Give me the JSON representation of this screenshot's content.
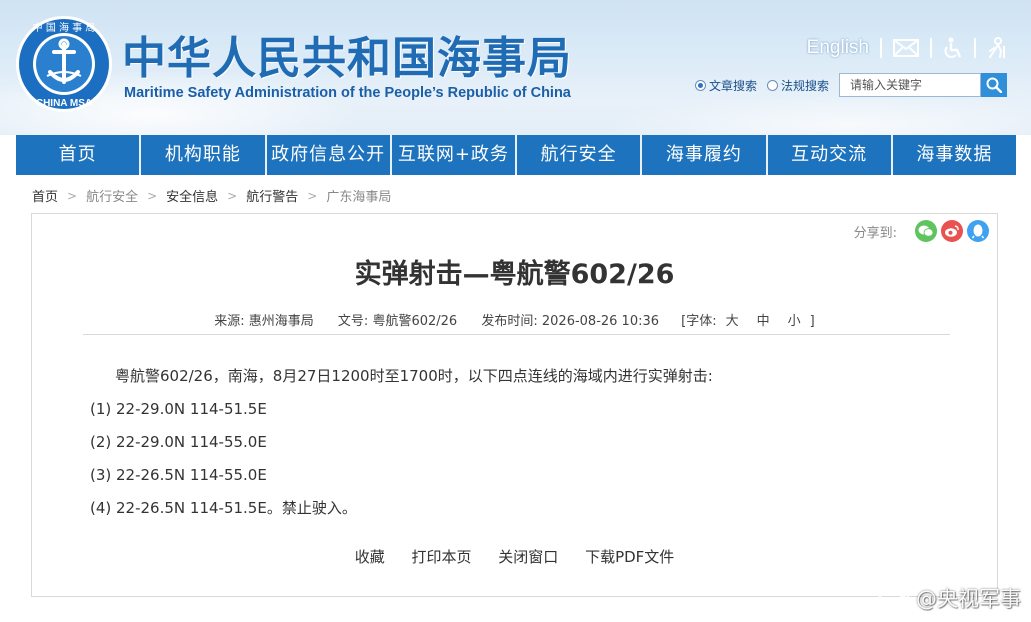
{
  "header": {
    "title": "中华人民共和国海事局",
    "subtitle": "Maritime Safety Administration of the People’s Republic of China",
    "emblem_text_top": "中 国 海 事 局",
    "emblem_text_bottom": "CHINA MSA",
    "english_link": "English",
    "search": {
      "options": [
        "文章搜索",
        "法规搜索"
      ],
      "selected": "文章搜索",
      "placeholder": "请输入关键字"
    }
  },
  "nav": {
    "items": [
      "首页",
      "机构职能",
      "政府信息公开",
      "互联网+政务",
      "航行安全",
      "海事履约",
      "互动交流",
      "海事数据"
    ]
  },
  "breadcrumb": [
    "首页",
    "航行安全",
    "安全信息",
    "航行警告",
    "广东海事局"
  ],
  "article": {
    "share_label": "分享到:",
    "title": "实弹射击—粤航警602/26",
    "source_label": "来源:",
    "source": "惠州海事局",
    "docno_label": "文号:",
    "docno": "粤航警602/26",
    "date_label": "发布时间:",
    "date": "2026-08-26 10:36",
    "font_label": "[字体:",
    "font_sizes": [
      "大",
      "中",
      "小"
    ],
    "font_close": "]",
    "lead": "粤航警602/26，南海，8月27日1200时至1700时，以下四点连线的海域内进行实弹射击:",
    "points": [
      "(1)  22-29.0N 114-51.5E",
      "(2)  22-29.0N 114-55.0E",
      "(3)  22-26.5N 114-55.0E",
      "(4)  22-26.5N 114-51.5E。禁止驶入。"
    ],
    "actions": [
      "收藏",
      "打印本页",
      "关闭窗口",
      "下载PDF文件"
    ]
  },
  "watermark": "@央视军事",
  "colors": {
    "nav_bg": "#1e73be",
    "title_blue": "#1f6cb5",
    "wechat": "#5fc35f",
    "weibo": "#e8524f",
    "qq": "#3ea2f0"
  }
}
